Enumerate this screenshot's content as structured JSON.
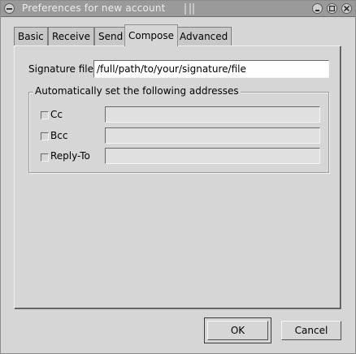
{
  "window": {
    "title": "Preferences for new account"
  },
  "tabs": [
    {
      "label": "Basic",
      "active": false
    },
    {
      "label": "Receive",
      "active": false
    },
    {
      "label": "Send",
      "active": false
    },
    {
      "label": "Compose",
      "active": true
    },
    {
      "label": "Advanced",
      "active": false
    }
  ],
  "compose": {
    "signature_label": "Signature file",
    "signature_value": "/full/path/to/your/signature/file",
    "frame_label": "Automatically set the following addresses",
    "addresses": [
      {
        "label": "Cc",
        "checked": false,
        "value": ""
      },
      {
        "label": "Bcc",
        "checked": false,
        "value": ""
      },
      {
        "label": "Reply-To",
        "checked": false,
        "value": ""
      }
    ]
  },
  "buttons": {
    "ok_label": "OK",
    "cancel_label": "Cancel"
  },
  "icons": {
    "window_menu": "window-menu-icon",
    "minimize": "minimize-icon",
    "maximize": "maximize-icon",
    "close": "close-icon"
  }
}
